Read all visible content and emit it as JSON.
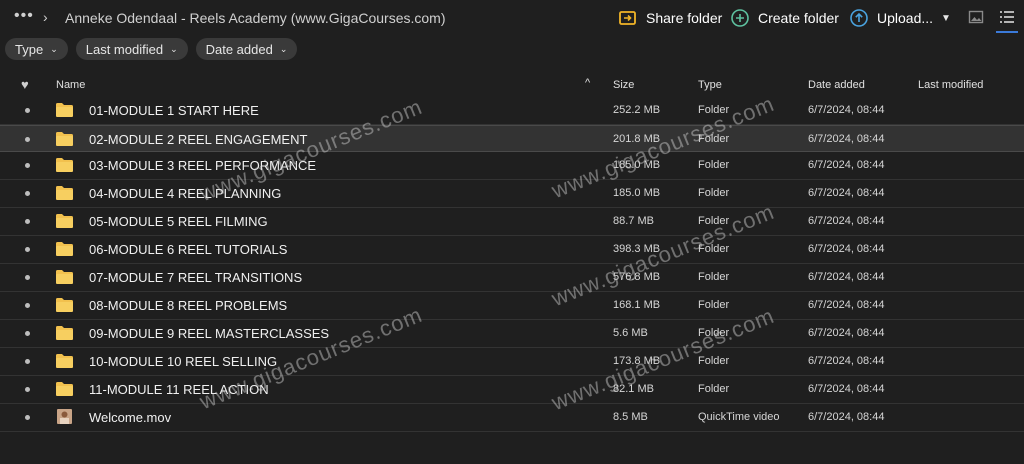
{
  "breadcrumb": {
    "more": "•••",
    "separator": "›",
    "current": "Anneke Odendaal - Reels Academy (www.GigaCourses.com)"
  },
  "actions": {
    "share": "Share folder",
    "create": "Create folder",
    "upload": "Upload..."
  },
  "colors": {
    "accent": "#3b7ad9",
    "folder": "#f2c14e",
    "share_icon": "#f2b527",
    "create_icon": "#5ec2a0",
    "upload_icon": "#4aa3df"
  },
  "filters": [
    "Type",
    "Last modified",
    "Date added"
  ],
  "columns": {
    "favorite": "♥",
    "name": "Name",
    "sort": "^",
    "size": "Size",
    "type": "Type",
    "date_added": "Date added",
    "last_modified": "Last modified"
  },
  "rows": [
    {
      "name": "01-MODULE 1 START HERE",
      "size": "252.2 MB",
      "type": "Folder",
      "date": "6/7/2024, 08:44",
      "icon": "folder-icon"
    },
    {
      "name": "02-MODULE 2 REEL ENGAGEMENT",
      "size": "201.8 MB",
      "type": "Folder",
      "date": "6/7/2024, 08:44",
      "icon": "folder-icon"
    },
    {
      "name": "03-MODULE 3 REEL PERFORMANCE",
      "size": "185.0 MB",
      "type": "Folder",
      "date": "6/7/2024, 08:44",
      "icon": "folder-icon"
    },
    {
      "name": "04-MODULE 4 REEL PLANNING",
      "size": "185.0 MB",
      "type": "Folder",
      "date": "6/7/2024, 08:44",
      "icon": "folder-icon"
    },
    {
      "name": "05-MODULE 5 REEL FILMING",
      "size": "88.7 MB",
      "type": "Folder",
      "date": "6/7/2024, 08:44",
      "icon": "folder-icon"
    },
    {
      "name": "06-MODULE 6 REEL TUTORIALS",
      "size": "398.3 MB",
      "type": "Folder",
      "date": "6/7/2024, 08:44",
      "icon": "folder-icon"
    },
    {
      "name": "07-MODULE 7 REEL TRANSITIONS",
      "size": "576.8 MB",
      "type": "Folder",
      "date": "6/7/2024, 08:44",
      "icon": "folder-icon"
    },
    {
      "name": "08-MODULE 8 REEL PROBLEMS",
      "size": "168.1 MB",
      "type": "Folder",
      "date": "6/7/2024, 08:44",
      "icon": "folder-icon"
    },
    {
      "name": "09-MODULE 9 REEL MASTERCLASSES",
      "size": "5.6 MB",
      "type": "Folder",
      "date": "6/7/2024, 08:44",
      "icon": "folder-icon"
    },
    {
      "name": "10-MODULE 10 REEL SELLING",
      "size": "173.8 MB",
      "type": "Folder",
      "date": "6/7/2024, 08:44",
      "icon": "folder-icon"
    },
    {
      "name": "11-MODULE 11 REEL ACTION",
      "size": "82.1 MB",
      "type": "Folder",
      "date": "6/7/2024, 08:44",
      "icon": "folder-icon"
    },
    {
      "name": "Welcome.mov",
      "size": "8.5 MB",
      "type": "QuickTime video",
      "date": "6/7/2024, 08:44",
      "icon": "video-thumbnail-icon"
    }
  ],
  "watermark": "www.gigacourses.com"
}
